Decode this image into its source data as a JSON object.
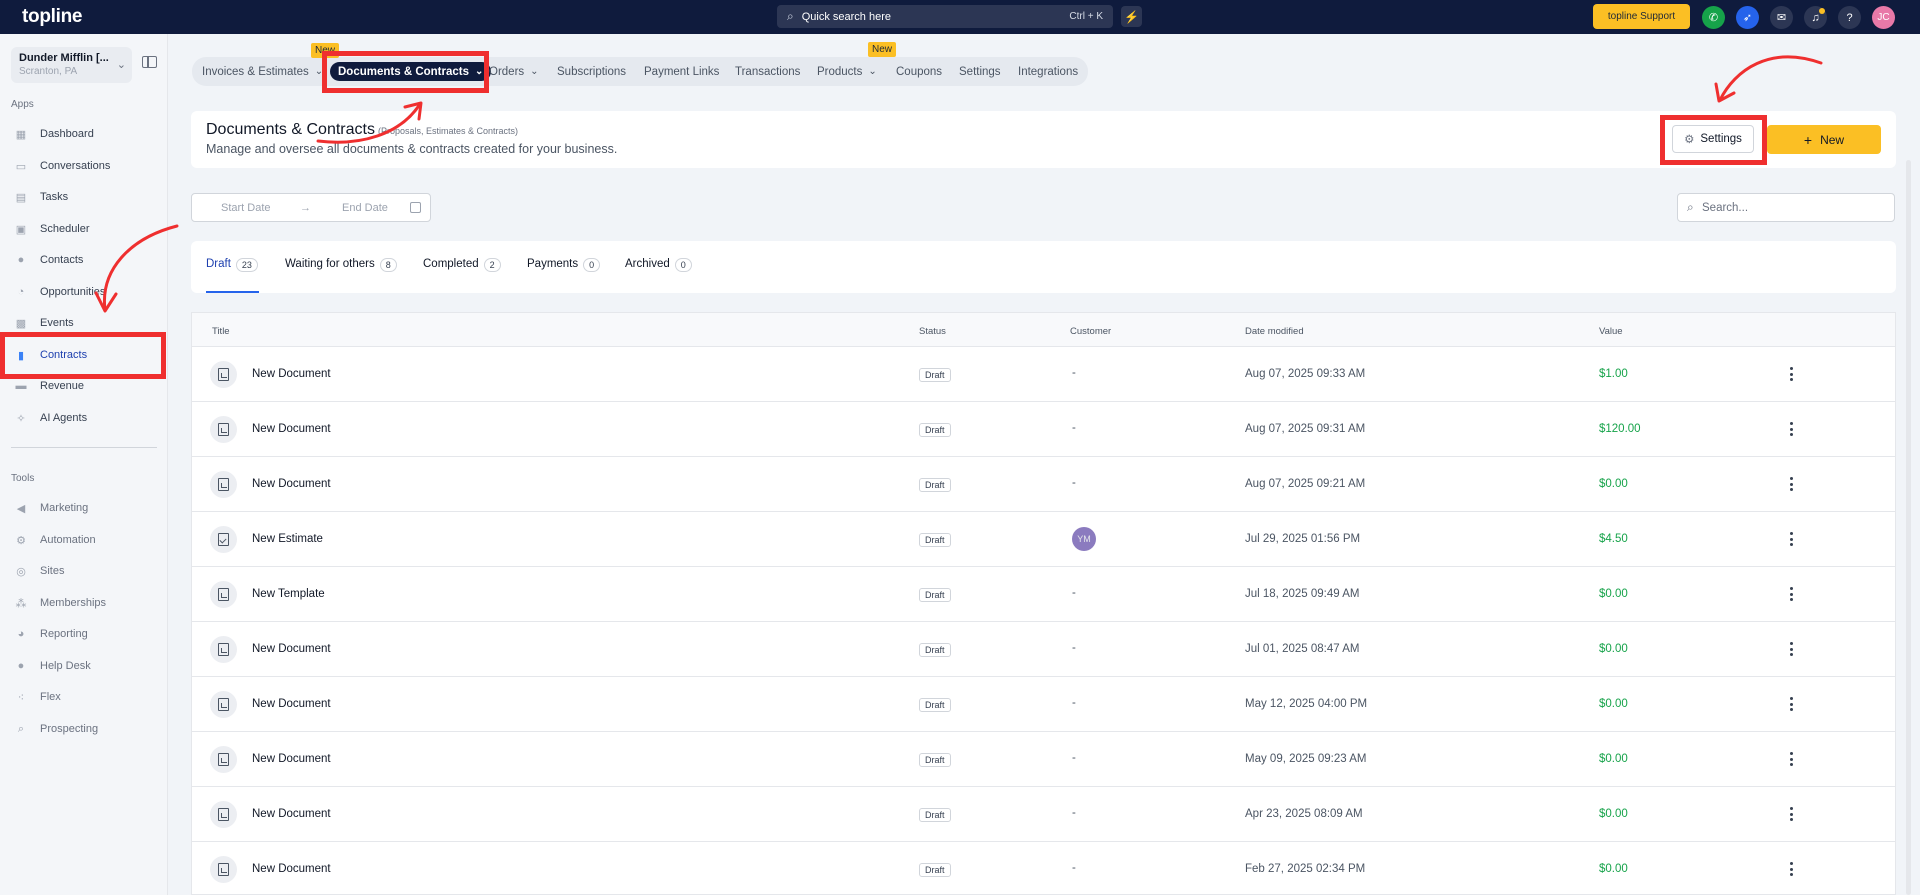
{
  "topbar": {
    "logo": "topline",
    "search_placeholder": "Quick search here",
    "search_shortcut": "Ctrl + K",
    "support_label": "topline Support",
    "avatar_initials": "JC"
  },
  "sidebar": {
    "company_name": "Dunder Mifflin [...",
    "company_location": "Scranton, PA",
    "apps_label": "Apps",
    "apps": [
      {
        "label": "Dashboard",
        "icon": "dashboard-icon"
      },
      {
        "label": "Conversations",
        "icon": "chat-icon"
      },
      {
        "label": "Tasks",
        "icon": "tasks-icon"
      },
      {
        "label": "Scheduler",
        "icon": "calendar-icon"
      },
      {
        "label": "Contacts",
        "icon": "user-icon"
      },
      {
        "label": "Opportunities",
        "icon": "opportunities-icon"
      },
      {
        "label": "Events",
        "icon": "events-icon"
      },
      {
        "label": "Contracts",
        "icon": "document-icon",
        "active": true
      },
      {
        "label": "Revenue",
        "icon": "revenue-icon"
      },
      {
        "label": "AI Agents",
        "icon": "sparkle-icon"
      }
    ],
    "tools_label": "Tools",
    "tools": [
      {
        "label": "Marketing",
        "icon": "megaphone-icon"
      },
      {
        "label": "Automation",
        "icon": "automation-icon"
      },
      {
        "label": "Sites",
        "icon": "sites-icon"
      },
      {
        "label": "Memberships",
        "icon": "memberships-icon"
      },
      {
        "label": "Reporting",
        "icon": "reporting-icon"
      },
      {
        "label": "Help Desk",
        "icon": "help-icon"
      },
      {
        "label": "Flex",
        "icon": "flex-icon"
      },
      {
        "label": "Prospecting",
        "icon": "search-icon"
      }
    ]
  },
  "tabs": {
    "items": [
      {
        "label": "Invoices & Estimates",
        "dropdown": true
      },
      {
        "label": "Documents & Contracts",
        "dropdown": true,
        "active": true
      },
      {
        "label": "Orders",
        "dropdown": true
      },
      {
        "label": "Subscriptions"
      },
      {
        "label": "Payment Links"
      },
      {
        "label": "Transactions"
      },
      {
        "label": "Products",
        "dropdown": true
      },
      {
        "label": "Coupons"
      },
      {
        "label": "Settings"
      },
      {
        "label": "Integrations"
      }
    ],
    "new_badge": "New"
  },
  "header": {
    "title": "Documents & Contracts",
    "subtitle": "(Proposals, Estimates & Contracts)",
    "description": "Manage and oversee all documents & contracts created for your business.",
    "settings_label": "Settings",
    "new_label": "New"
  },
  "filters": {
    "start_date": "Start Date",
    "end_date": "End Date",
    "search_placeholder": "Search..."
  },
  "status_tabs": [
    {
      "label": "Draft",
      "count": "23",
      "active": true
    },
    {
      "label": "Waiting for others",
      "count": "8"
    },
    {
      "label": "Completed",
      "count": "2"
    },
    {
      "label": "Payments",
      "count": "0"
    },
    {
      "label": "Archived",
      "count": "0"
    }
  ],
  "table": {
    "columns": [
      "Title",
      "Status",
      "Customer",
      "Date modified",
      "Value"
    ],
    "rows": [
      {
        "title": "New Document",
        "status": "Draft",
        "customer": "-",
        "date": "Aug 07, 2025 09:33 AM",
        "value": "$1.00"
      },
      {
        "title": "New Document",
        "status": "Draft",
        "customer": "-",
        "date": "Aug 07, 2025 09:31 AM",
        "value": "$120.00"
      },
      {
        "title": "New Document",
        "status": "Draft",
        "customer": "-",
        "date": "Aug 07, 2025 09:21 AM",
        "value": "$0.00"
      },
      {
        "title": "New Estimate",
        "status": "Draft",
        "customer": "YM",
        "date": "Jul 29, 2025 01:56 PM",
        "value": "$4.50"
      },
      {
        "title": "New Template",
        "status": "Draft",
        "customer": "-",
        "date": "Jul 18, 2025 09:49 AM",
        "value": "$0.00"
      },
      {
        "title": "New Document",
        "status": "Draft",
        "customer": "-",
        "date": "Jul 01, 2025 08:47 AM",
        "value": "$0.00"
      },
      {
        "title": "New Document",
        "status": "Draft",
        "customer": "-",
        "date": "May 12, 2025 04:00 PM",
        "value": "$0.00"
      },
      {
        "title": "New Document",
        "status": "Draft",
        "customer": "-",
        "date": "May 09, 2025 09:23 AM",
        "value": "$0.00"
      },
      {
        "title": "New Document",
        "status": "Draft",
        "customer": "-",
        "date": "Apr 23, 2025 08:09 AM",
        "value": "$0.00"
      },
      {
        "title": "New Document",
        "status": "Draft",
        "customer": "-",
        "date": "Feb 27, 2025 02:34 PM",
        "value": "$0.00"
      }
    ]
  },
  "colors": {
    "topbar": "#0f1b3d",
    "accent_yellow": "#fbbf24",
    "value_green": "#16a34a",
    "annotation_red": "#ef2f2f",
    "active_blue": "#2563eb"
  }
}
